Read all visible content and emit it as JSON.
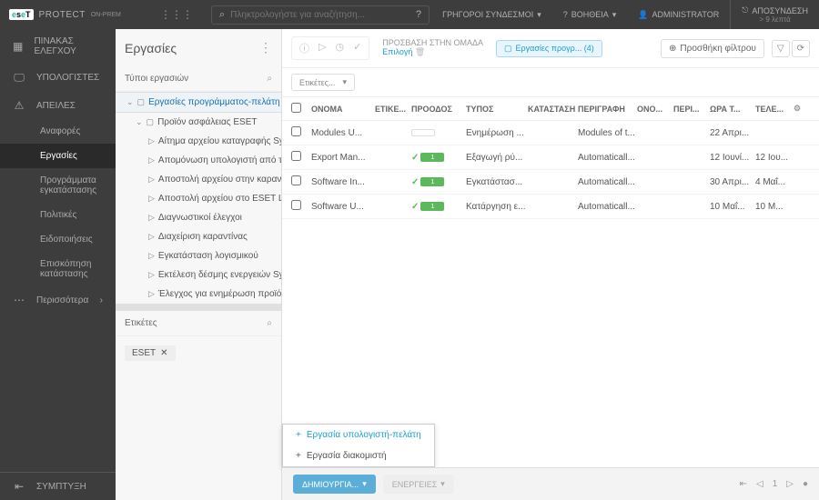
{
  "brand": {
    "name": "PROTECT",
    "suffix": "ON-PREM"
  },
  "search": {
    "placeholder": "Πληκτρολογήστε για αναζήτηση..."
  },
  "topLinks": {
    "quick": "ΓΡΗΓΟΡΟΙ ΣΥΝΔΕΣΜΟΙ",
    "help": "ΒΟΗΘΕΙΑ",
    "admin": "ADMINISTRATOR",
    "logout": "ΑΠΟΣΥΝΔΕΣΗ",
    "logoutSub": "> 9 λεπτά"
  },
  "nav": {
    "dashboard": "ΠΙΝΑΚΑΣ ΕΛΕΓΧΟΥ",
    "computers": "ΥΠΟΛΟΓΙΣΤΕΣ",
    "threats": "ΑΠΕΙΛΕΣ",
    "reports": "Αναφορές",
    "tasks": "Εργασίες",
    "installers": "Προγράμματα εγκατάστασης",
    "policies": "Πολιτικές",
    "notifications": "Ειδοποιήσεις",
    "status": "Επισκόπηση κατάστασης",
    "more": "Περισσότερα",
    "collapse": "ΣΥΜΠΤΥΞΗ"
  },
  "panel": {
    "title": "Εργασίες",
    "typesHeader": "Τύποι εργασιών",
    "tagsHeader": "Ετικέτες",
    "tree": {
      "root": "Εργασίες προγράμματος-πελάτη",
      "eset": "Προϊόν ασφάλειας ESET",
      "items": [
        "Αίτημα αρχείου καταγραφής SysIns...",
        "Απομόνωση υπολογιστή από το δ...",
        "Αποστολή αρχείου στην καραντίνα",
        "Αποστολή αρχείου στο ESET LiveG...",
        "Διαγνωστικοί έλεγχοι",
        "Διαχείριση καραντίνας",
        "Εγκατάσταση λογισμικού",
        "Εκτέλεση δέσμης ενεργειών SysIns...",
        "Έλεγχος για ενημέρωση προϊόντος"
      ]
    },
    "tag": "ESET"
  },
  "toolbar": {
    "accessLabel": "ΠΡΟΣΒΑΣΗ ΣΤΗΝ ΟΜΑΔΑ",
    "accessSelect": "Επιλογή",
    "chip": "Εργασίες προγρ... (4)",
    "addFilter": "Προσθήκη φίλτρου",
    "tagSelect": "Ετικέτες..."
  },
  "columns": {
    "name": "ΟΝΟΜΑ",
    "tags": "ΕΤΙΚΕ...",
    "progress": "ΠΡΟΟΔΟΣ",
    "type": "ΤΥΠΟΣ",
    "status": "ΚΑΤΑΣΤΑΣΗ",
    "desc": "ΠΕΡΙΓΡΑΦΗ",
    "ono": "ΟΝΟ...",
    "peri": "ΠΕΡΙ...",
    "date1": "ΩΡΑ Τ...",
    "date2": "ΤΕΛΕ..."
  },
  "rows": [
    {
      "name": "Modules U...",
      "prog": "",
      "type": "Ενημέρωση ...",
      "desc": "Modules of t...",
      "d1": "22 Απρι...",
      "d2": ""
    },
    {
      "name": "Export Man...",
      "prog": "1",
      "type": "Εξαγωγή ρύ...",
      "desc": "Automaticall...",
      "d1": "12 Ιουνί...",
      "d2": "12 Ιου..."
    },
    {
      "name": "Software In...",
      "prog": "1",
      "type": "Εγκατάστασ...",
      "desc": "Automaticall...",
      "d1": "30 Απρι...",
      "d2": "4 Μαΐ..."
    },
    {
      "name": "Software U...",
      "prog": "1",
      "type": "Κατάργηση ε...",
      "desc": "Automaticall...",
      "d1": "10 Μαΐ...",
      "d2": "10 Μ..."
    }
  ],
  "popup": {
    "client": "Εργασία υπολογιστή-πελάτη",
    "server": "Εργασία διακομιστή"
  },
  "footer": {
    "create": "ΔΗΜΙΟΥΡΓΙΑ...",
    "actions": "ΕΝΕΡΓΕΙΕΣ",
    "page": "1"
  }
}
